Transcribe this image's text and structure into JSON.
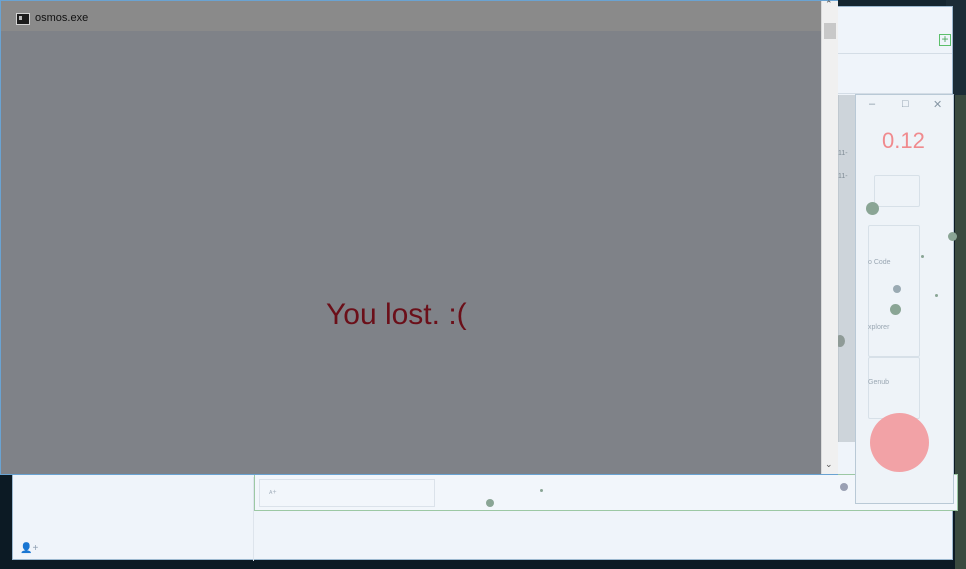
{
  "window": {
    "title": "osmos.exe",
    "message": "You lost. :(",
    "scroll_up_glyph": "⌃",
    "scroll_down_glyph": "⌄"
  },
  "osmos_panel": {
    "score": "0.12",
    "minimize_glyph": "–",
    "maximize_glyph": "□",
    "close_glyph": "✕",
    "items": [
      "o Code",
      "xplorer",
      "Genub"
    ]
  },
  "background_window": {
    "add_button_glyph": "+",
    "add_user_glyph": "👤+",
    "inner_label": "ᴀ+"
  },
  "list_ticks": [
    "11-",
    "11-"
  ],
  "colors": {
    "game_background": "#7f8288",
    "lose_text": "#6b0f19",
    "score_text": "#f08a8e",
    "player_blob": "#f2a2a6",
    "mote": "#90a59c"
  }
}
